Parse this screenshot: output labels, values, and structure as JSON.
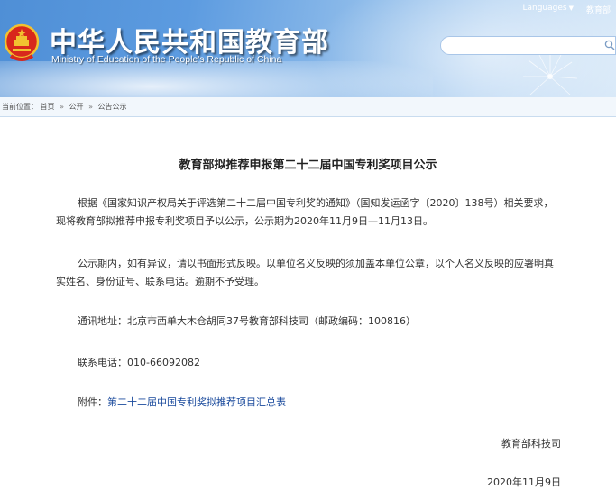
{
  "header": {
    "title_cn": "中华人民共和国教育部",
    "title_en": "Ministry of Education of the People's Republic of China",
    "emblem": "national-emblem",
    "links": {
      "languages": "Languages",
      "mobile": "教育部"
    },
    "search": {
      "placeholder": "",
      "icon": "search-icon"
    },
    "colors": {
      "sky_start": "#4f8fd6",
      "sky_end": "#d7e8f8"
    }
  },
  "breadcrumb": {
    "prefix": "当前位置：",
    "items": [
      "首页",
      "公开",
      "公告公示"
    ],
    "separator": "»"
  },
  "article": {
    "title": "教育部拟推荐申报第二十二届中国专利奖项目公示",
    "paragraphs": [
      "根据《国家知识产权局关于评选第二十二届中国专利奖的通知》（国知发运函字〔2020〕138号）相关要求，现将教育部拟推荐申报专利奖项目予以公示，公示期为2020年11月9日—11月13日。",
      "公示期内，如有异议，请以书面形式反映。以单位名义反映的须加盖本单位公章，以个人名义反映的应署明真实姓名、身份证号、联系电话。逾期不予受理。",
      "通讯地址：北京市西单大木仓胡同37号教育部科技司（邮政编码：100816）",
      "联系电话：010-66092082"
    ],
    "attachment": {
      "label": "附件：",
      "link_text": "第二十二届中国专利奖拟推荐项目汇总表",
      "link_color": "#1a4a9c"
    },
    "signature": "教育部科技司",
    "date": "2020年11月9日"
  }
}
